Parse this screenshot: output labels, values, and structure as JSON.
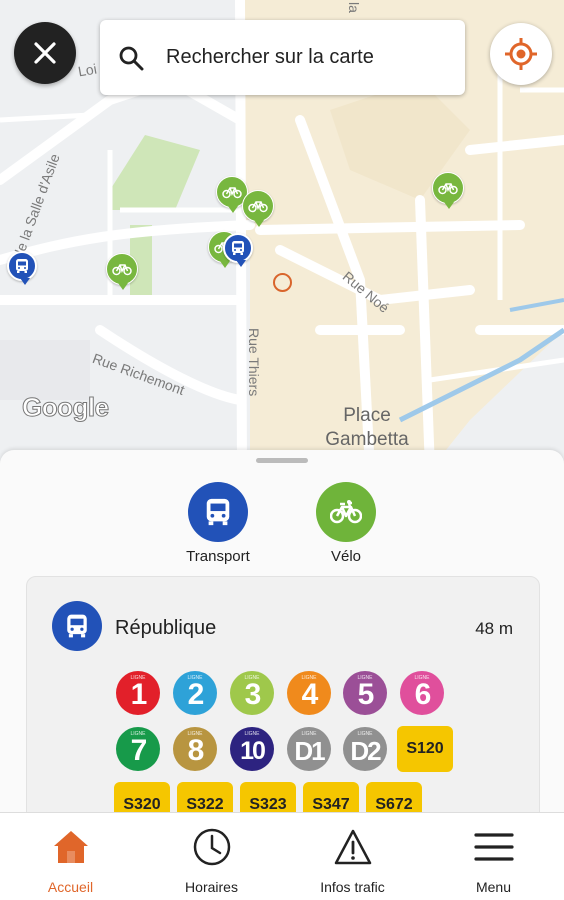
{
  "search": {
    "placeholder": "Rechercher sur la carte"
  },
  "map": {
    "street_labels": [
      "de la Salle d'Asile",
      "Rue Richemont",
      "Rue Thiers",
      "Rue Noé",
      "Loi",
      "la"
    ],
    "place_label": [
      "Place",
      "Gambetta"
    ],
    "attribution": "Google"
  },
  "modes": [
    {
      "label": "Transport",
      "color": "#2252b8"
    },
    {
      "label": "Vélo",
      "color": "#6fb43a"
    }
  ],
  "stop": {
    "name": "République",
    "distance": "48 m",
    "lines": [
      {
        "label": "1",
        "color": "#e2202a"
      },
      {
        "label": "2",
        "color": "#2ea2d8"
      },
      {
        "label": "3",
        "color": "#9fc84b"
      },
      {
        "label": "4",
        "color": "#f08a1c"
      },
      {
        "label": "5",
        "color": "#9b4f97"
      },
      {
        "label": "6",
        "color": "#e04f9c"
      },
      {
        "label": "7",
        "color": "#179a4a"
      },
      {
        "label": "8",
        "color": "#b89540"
      },
      {
        "label": "10",
        "color": "#2d2380"
      },
      {
        "label": "D1",
        "color": "#909090"
      },
      {
        "label": "D2",
        "color": "#909090"
      }
    ],
    "express_lines": [
      "S120",
      "S320",
      "S322",
      "S323",
      "S347",
      "S672"
    ],
    "line_prefix": "LIGNE"
  },
  "nav": {
    "items": [
      {
        "label": "Accueil",
        "icon": "home-icon",
        "active": true
      },
      {
        "label": "Horaires",
        "icon": "clock-icon",
        "active": false
      },
      {
        "label": "Infos trafic",
        "icon": "warning-icon",
        "active": false
      },
      {
        "label": "Menu",
        "icon": "menu-icon",
        "active": false
      }
    ],
    "active_color": "#e0662a"
  }
}
